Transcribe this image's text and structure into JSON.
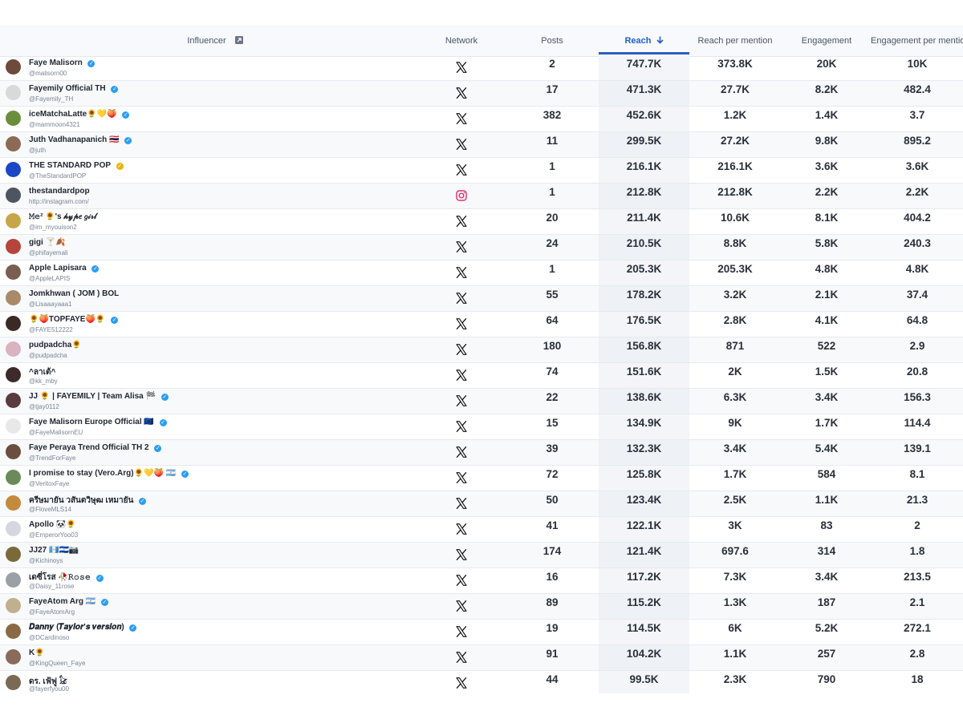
{
  "header": {
    "influencer": "Influencer",
    "network": "Network",
    "posts": "Posts",
    "reach": "Reach",
    "reach_per_mention": "Reach per mention",
    "engagement": "Engagement",
    "engagement_per_mention": "Engagement per mention"
  },
  "colors": {
    "accent": "#2b5fbf",
    "verified": "#2a9df4",
    "instagram": "#e1306c"
  },
  "rows": [
    {
      "name": "Faye Malisorn",
      "handle": "@malisorn00",
      "verified": "blue",
      "network": "x",
      "posts": "2",
      "reach": "747.7K",
      "rpm": "373.8K",
      "eng": "20K",
      "epm": "10K"
    },
    {
      "name": "Fayemily Official TH",
      "handle": "@Fayemily_TH",
      "verified": "blue",
      "network": "x",
      "posts": "17",
      "reach": "471.3K",
      "rpm": "27.7K",
      "eng": "8.2K",
      "epm": "482.4"
    },
    {
      "name": "iceMatchaLatte🌻💛🍑",
      "handle": "@mammoon4321",
      "verified": "blue",
      "network": "x",
      "posts": "382",
      "reach": "452.6K",
      "rpm": "1.2K",
      "eng": "1.4K",
      "epm": "3.7"
    },
    {
      "name": "Juth Vadhanapanich 🇹🇭",
      "handle": "@juth",
      "verified": "blue",
      "network": "x",
      "posts": "11",
      "reach": "299.5K",
      "rpm": "27.2K",
      "eng": "9.8K",
      "epm": "895.2"
    },
    {
      "name": "THE STANDARD POP",
      "handle": "@TheStandardPOP",
      "verified": "gold",
      "network": "x",
      "posts": "1",
      "reach": "216.1K",
      "rpm": "216.1K",
      "eng": "3.6K",
      "epm": "3.6K"
    },
    {
      "name": "thestandardpop",
      "handle": "http://instagram.com/",
      "verified": "",
      "network": "instagram",
      "posts": "1",
      "reach": "212.8K",
      "rpm": "212.8K",
      "eng": "2.2K",
      "epm": "2.2K"
    },
    {
      "name": "𝙼𝚎² 🌻's 𝒽𝓎𝓅𝑒 𝑔𝒾𝓇𝓁",
      "handle": "@im_myouison2",
      "verified": "",
      "network": "x",
      "posts": "20",
      "reach": "211.4K",
      "rpm": "10.6K",
      "eng": "8.1K",
      "epm": "404.2"
    },
    {
      "name": "gigi 🍸🍂",
      "handle": "@phifayemali",
      "verified": "",
      "network": "x",
      "posts": "24",
      "reach": "210.5K",
      "rpm": "8.8K",
      "eng": "5.8K",
      "epm": "240.3"
    },
    {
      "name": "Apple Lapisara",
      "handle": "@AppleLAPIS",
      "verified": "blue",
      "network": "x",
      "posts": "1",
      "reach": "205.3K",
      "rpm": "205.3K",
      "eng": "4.8K",
      "epm": "4.8K"
    },
    {
      "name": "Jomkhwan ( JOM ) BOL",
      "handle": "@Lisaaayaaa1",
      "verified": "",
      "network": "x",
      "posts": "55",
      "reach": "178.2K",
      "rpm": "3.2K",
      "eng": "2.1K",
      "epm": "37.4"
    },
    {
      "name": "🌻🍑TOPFAYE🍑🌻",
      "handle": "@FAYE512222",
      "verified": "blue",
      "network": "x",
      "posts": "64",
      "reach": "176.5K",
      "rpm": "2.8K",
      "eng": "4.1K",
      "epm": "64.8"
    },
    {
      "name": "pudpadcha🌻",
      "handle": "@pudpadcha",
      "verified": "",
      "network": "x",
      "posts": "180",
      "reach": "156.8K",
      "rpm": "871",
      "eng": "522",
      "epm": "2.9"
    },
    {
      "name": "^ลาเต้^",
      "handle": "@kk_mby",
      "verified": "",
      "network": "x",
      "posts": "74",
      "reach": "151.6K",
      "rpm": "2K",
      "eng": "1.5K",
      "epm": "20.8"
    },
    {
      "name": "JJ 🌻 | FAYEMILY | Team Alisa 🏁",
      "handle": "@tjay0112",
      "verified": "blue",
      "network": "x",
      "posts": "22",
      "reach": "138.6K",
      "rpm": "6.3K",
      "eng": "3.4K",
      "epm": "156.3"
    },
    {
      "name": "Faye Malisorn Europe Official 🇪🇺",
      "handle": "@FayeMalisornEU",
      "verified": "blue",
      "network": "x",
      "posts": "15",
      "reach": "134.9K",
      "rpm": "9K",
      "eng": "1.7K",
      "epm": "114.4"
    },
    {
      "name": "Faye Peraya Trend Official TH 2",
      "handle": "@TrendForFaye",
      "verified": "blue",
      "network": "x",
      "posts": "39",
      "reach": "132.3K",
      "rpm": "3.4K",
      "eng": "5.4K",
      "epm": "139.1"
    },
    {
      "name": "I promise to stay (Vero.Arg)🌻💛🍑 🇦🇷",
      "handle": "@VeritoxFaye",
      "verified": "blue",
      "network": "x",
      "posts": "72",
      "reach": "125.8K",
      "rpm": "1.7K",
      "eng": "584",
      "epm": "8.1"
    },
    {
      "name": "ครีษมายัน วสันตวิษุฒ เหมายัน",
      "handle": "@FloveMLS14",
      "verified": "blue",
      "network": "x",
      "posts": "50",
      "reach": "123.4K",
      "rpm": "2.5K",
      "eng": "1.1K",
      "epm": "21.3"
    },
    {
      "name": "Apollo 🐼🌻",
      "handle": "@EmperorYoo03",
      "verified": "",
      "network": "x",
      "posts": "41",
      "reach": "122.1K",
      "rpm": "3K",
      "eng": "83",
      "epm": "2"
    },
    {
      "name": "JJ27 🇬🇹🇸🇻📷",
      "handle": "@Kichinoys",
      "verified": "",
      "network": "x",
      "posts": "174",
      "reach": "121.4K",
      "rpm": "697.6",
      "eng": "314",
      "epm": "1.8"
    },
    {
      "name": "เดซี่โรส 🥀𝚁𝚘𝚜𝚎",
      "handle": "@Daisy_11rose",
      "verified": "blue",
      "network": "x",
      "posts": "16",
      "reach": "117.2K",
      "rpm": "7.3K",
      "eng": "3.4K",
      "epm": "213.5"
    },
    {
      "name": "FayeAtom Arg 🇦🇷",
      "handle": "@FayeAtomArg",
      "verified": "blue",
      "network": "x",
      "posts": "89",
      "reach": "115.2K",
      "rpm": "1.3K",
      "eng": "187",
      "epm": "2.1"
    },
    {
      "name": "𝑫𝒂𝒏𝒏𝒚 (𝑻𝒂𝒚𝒍𝒐𝒓'𝒔 𝒗𝒆𝒓𝒔𝒊𝒐𝒏)",
      "handle": "@DCardinoso",
      "verified": "blue",
      "network": "x",
      "posts": "19",
      "reach": "114.5K",
      "rpm": "6K",
      "eng": "5.2K",
      "epm": "272.1"
    },
    {
      "name": "K🌻",
      "handle": "@KingQueen_Faye",
      "verified": "",
      "network": "x",
      "posts": "91",
      "reach": "104.2K",
      "rpm": "1.1K",
      "eng": "257",
      "epm": "2.8"
    },
    {
      "name": "ดร. เฟ้ฟู 𓃠",
      "handle": "@fayerfyou00",
      "verified": "",
      "network": "x",
      "posts": "44",
      "reach": "99.5K",
      "rpm": "2.3K",
      "eng": "790",
      "epm": "18"
    }
  ]
}
